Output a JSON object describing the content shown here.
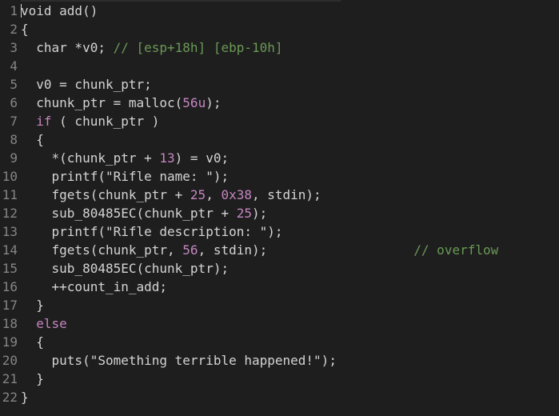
{
  "lines": [
    {
      "num": "1",
      "tokens": [
        {
          "t": "void add()",
          "c": ""
        }
      ]
    },
    {
      "num": "2",
      "tokens": [
        {
          "t": "{",
          "c": ""
        }
      ]
    },
    {
      "num": "3",
      "tokens": [
        {
          "t": "  char *v0; ",
          "c": ""
        },
        {
          "t": "// [esp+18h] [ebp-10h]",
          "c": "cm"
        }
      ]
    },
    {
      "num": "4",
      "tokens": []
    },
    {
      "num": "5",
      "tokens": [
        {
          "t": "  v0 = chunk_ptr;",
          "c": ""
        }
      ]
    },
    {
      "num": "6",
      "tokens": [
        {
          "t": "  chunk_ptr = malloc(",
          "c": ""
        },
        {
          "t": "56u",
          "c": "num"
        },
        {
          "t": ");",
          "c": ""
        }
      ]
    },
    {
      "num": "7",
      "tokens": [
        {
          "t": "  ",
          "c": ""
        },
        {
          "t": "if",
          "c": "kw"
        },
        {
          "t": " ( chunk_ptr )",
          "c": ""
        }
      ]
    },
    {
      "num": "8",
      "tokens": [
        {
          "t": "  {",
          "c": ""
        }
      ]
    },
    {
      "num": "9",
      "tokens": [
        {
          "t": "    *(chunk_ptr + ",
          "c": ""
        },
        {
          "t": "13",
          "c": "num"
        },
        {
          "t": ") = v0;",
          "c": ""
        }
      ]
    },
    {
      "num": "10",
      "tokens": [
        {
          "t": "    printf(\"Rifle name: \");",
          "c": ""
        }
      ]
    },
    {
      "num": "11",
      "tokens": [
        {
          "t": "    fgets(chunk_ptr + ",
          "c": ""
        },
        {
          "t": "25",
          "c": "num"
        },
        {
          "t": ", ",
          "c": ""
        },
        {
          "t": "0x38",
          "c": "num"
        },
        {
          "t": ", stdin);",
          "c": ""
        }
      ]
    },
    {
      "num": "12",
      "tokens": [
        {
          "t": "    sub_80485EC(chunk_ptr + ",
          "c": ""
        },
        {
          "t": "25",
          "c": "num"
        },
        {
          "t": ");",
          "c": ""
        }
      ]
    },
    {
      "num": "13",
      "tokens": [
        {
          "t": "    printf(\"Rifle description: \");",
          "c": ""
        }
      ]
    },
    {
      "num": "14",
      "tokens": [
        {
          "t": "    fgets(chunk_ptr, ",
          "c": ""
        },
        {
          "t": "56",
          "c": "num"
        },
        {
          "t": ", stdin);                   ",
          "c": ""
        },
        {
          "t": "// overflow",
          "c": "cm"
        }
      ]
    },
    {
      "num": "15",
      "tokens": [
        {
          "t": "    sub_80485EC(chunk_ptr);",
          "c": ""
        }
      ]
    },
    {
      "num": "16",
      "tokens": [
        {
          "t": "    ++count_in_add;",
          "c": ""
        }
      ]
    },
    {
      "num": "17",
      "tokens": [
        {
          "t": "  }",
          "c": ""
        }
      ]
    },
    {
      "num": "18",
      "tokens": [
        {
          "t": "  ",
          "c": ""
        },
        {
          "t": "else",
          "c": "kw"
        }
      ]
    },
    {
      "num": "19",
      "tokens": [
        {
          "t": "  {",
          "c": ""
        }
      ]
    },
    {
      "num": "20",
      "tokens": [
        {
          "t": "    puts(\"Something terrible happened!\");",
          "c": ""
        }
      ]
    },
    {
      "num": "21",
      "tokens": [
        {
          "t": "  }",
          "c": ""
        }
      ]
    },
    {
      "num": "22",
      "tokens": [
        {
          "t": "}",
          "c": ""
        }
      ]
    }
  ],
  "colors": {
    "background": "#1e1e1e",
    "text": "#d4d4d4",
    "keyword": "#c586c0",
    "number": "#c586c0",
    "comment": "#6a9955",
    "line_number": "#858585"
  }
}
